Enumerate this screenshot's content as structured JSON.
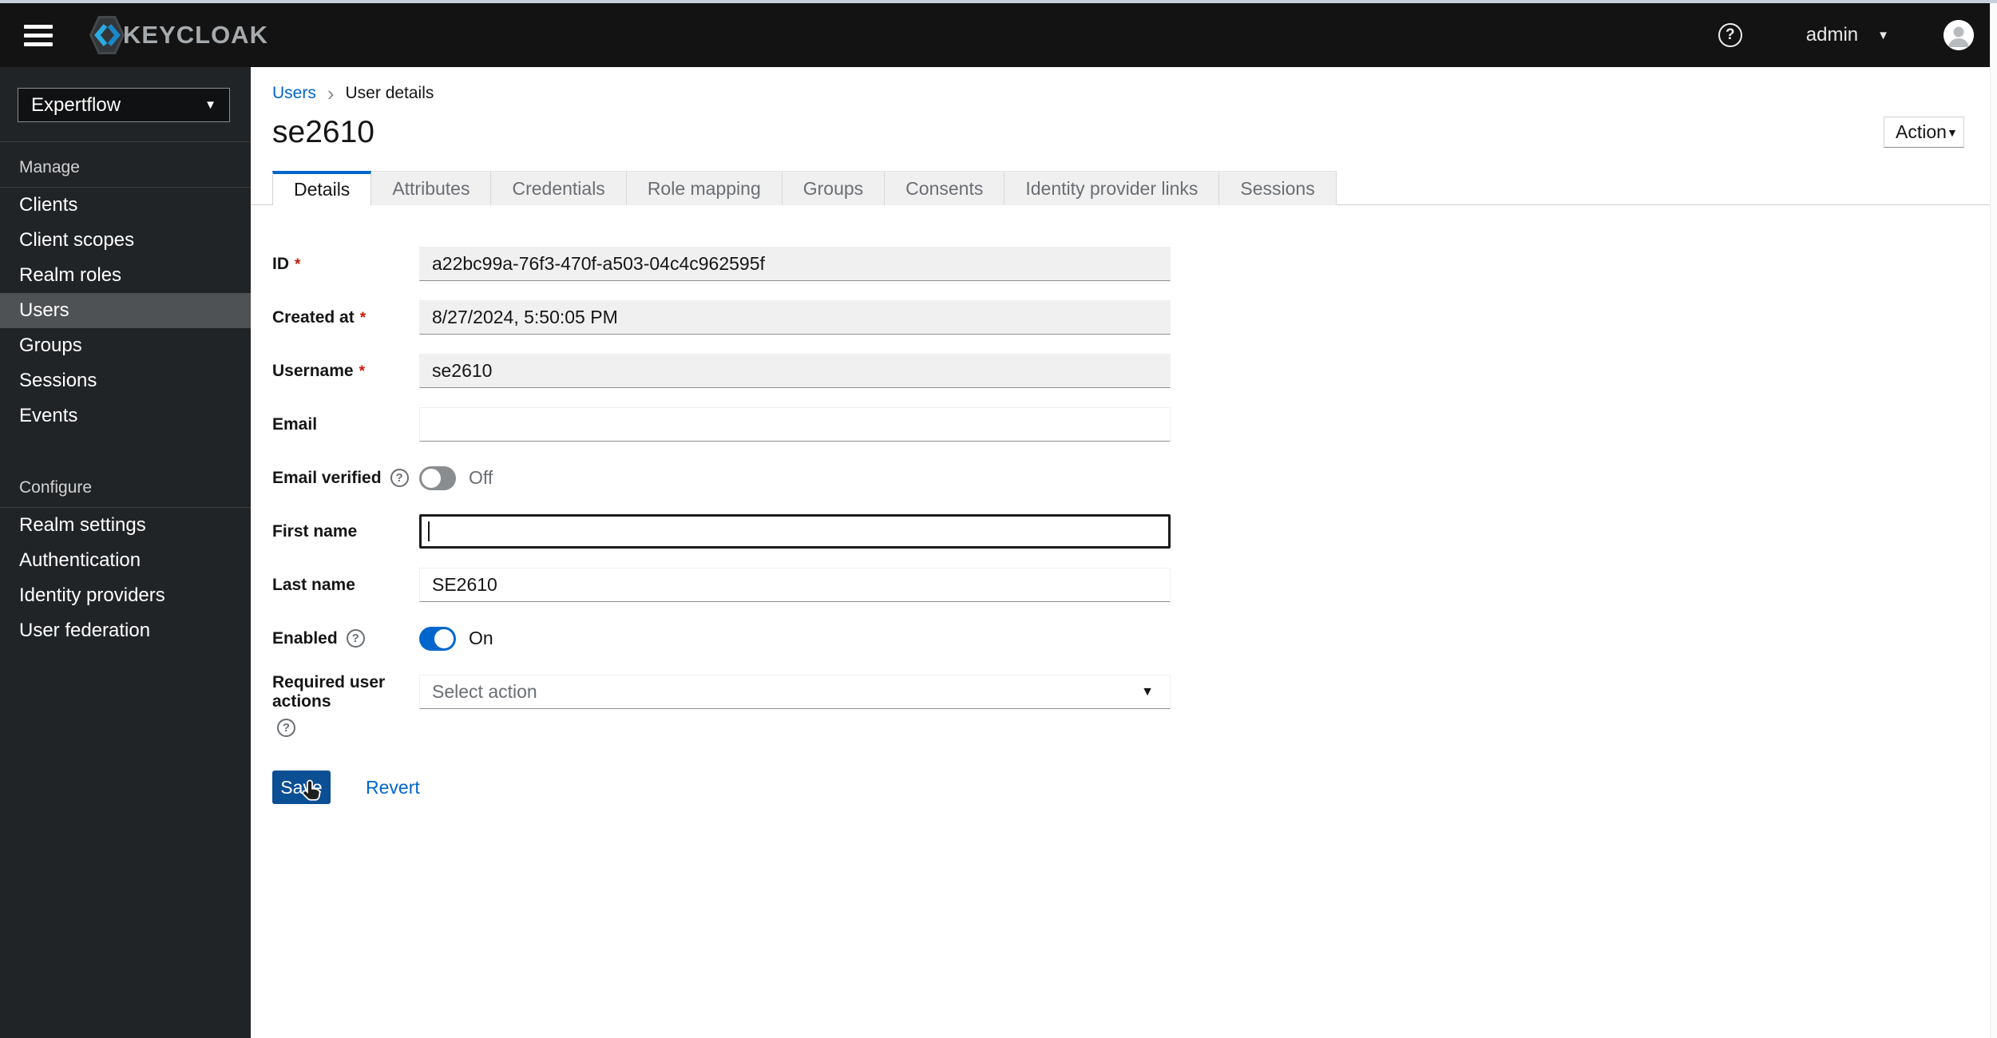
{
  "header": {
    "brand": "KEYCLOAK",
    "user": "admin"
  },
  "icons": {
    "caret_down": "▾",
    "caret_down_solid": "▼",
    "help_glyph": "?",
    "breadcrumb_sep": "›"
  },
  "sidebar": {
    "realm": "Expertflow",
    "sections": [
      {
        "label": "Manage",
        "items": [
          {
            "label": "Clients",
            "active": false
          },
          {
            "label": "Client scopes",
            "active": false
          },
          {
            "label": "Realm roles",
            "active": false
          },
          {
            "label": "Users",
            "active": true
          },
          {
            "label": "Groups",
            "active": false
          },
          {
            "label": "Sessions",
            "active": false
          },
          {
            "label": "Events",
            "active": false
          }
        ]
      },
      {
        "label": "Configure",
        "items": [
          {
            "label": "Realm settings",
            "active": false
          },
          {
            "label": "Authentication",
            "active": false
          },
          {
            "label": "Identity providers",
            "active": false
          },
          {
            "label": "User federation",
            "active": false
          }
        ]
      }
    ]
  },
  "breadcrumb": {
    "link": "Users",
    "current": "User details"
  },
  "page": {
    "title": "se2610",
    "action_button": "Action"
  },
  "tabs": [
    {
      "label": "Details",
      "active": true
    },
    {
      "label": "Attributes",
      "active": false
    },
    {
      "label": "Credentials",
      "active": false
    },
    {
      "label": "Role mapping",
      "active": false
    },
    {
      "label": "Groups",
      "active": false
    },
    {
      "label": "Consents",
      "active": false
    },
    {
      "label": "Identity provider links",
      "active": false
    },
    {
      "label": "Sessions",
      "active": false
    }
  ],
  "form": {
    "fields": [
      {
        "label": "ID",
        "required": true,
        "value": "a22bc99a-76f3-470f-a503-04c4c962595f",
        "readonly": true
      },
      {
        "label": "Created at",
        "required": true,
        "value": "8/27/2024, 5:50:05 PM",
        "readonly": true
      },
      {
        "label": "Username",
        "required": true,
        "value": "se2610",
        "readonly": true
      },
      {
        "label": "Email",
        "required": false,
        "value": "",
        "readonly": false
      },
      {
        "label": "Email verified",
        "type": "toggle",
        "state": false,
        "state_label": "Off",
        "help": true
      },
      {
        "label": "First name",
        "value": "",
        "focused": true
      },
      {
        "label": "Last name",
        "value": "SE2610"
      },
      {
        "label": "Enabled",
        "type": "toggle",
        "state": true,
        "state_label": "On",
        "help": true
      },
      {
        "label": "Required user actions",
        "type": "select",
        "placeholder": "Select action",
        "help": true
      }
    ],
    "buttons": {
      "save": "Save",
      "revert": "Revert"
    }
  },
  "misc": {
    "required_marker": "*"
  },
  "colors": {
    "accent_blue": "#0066cc",
    "save_button_blue": "#0d4f94",
    "header_bg": "#131314",
    "sidebar_bg": "#212427",
    "sidebar_selected_bg": "#4f5255",
    "readonly_input_bg": "#f0f0f0",
    "input_bottom_border": "#8a8d90",
    "tab_inactive_bg": "#f0f0f0",
    "muted_text": "#6a6e73",
    "required_red": "#c9190b",
    "focus_border": "#1b1b1b"
  }
}
